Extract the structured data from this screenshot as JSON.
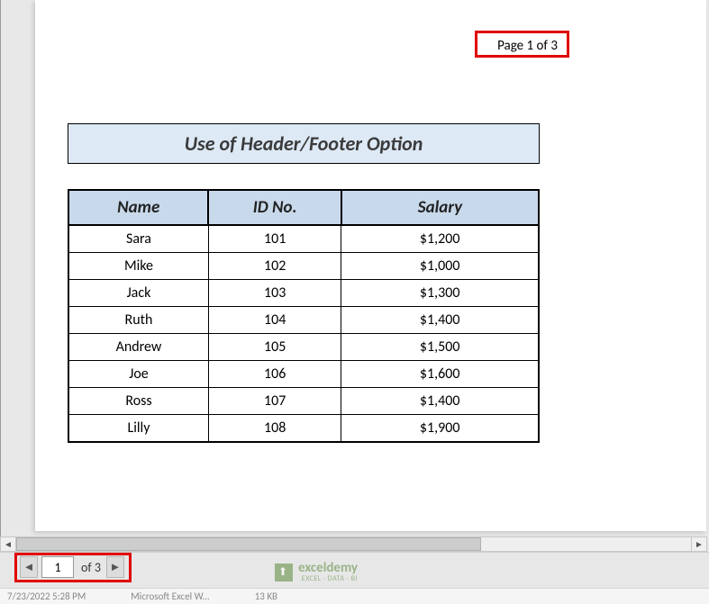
{
  "header": {
    "page_text": "Page 1 of 3"
  },
  "title": "Use of Header/Footer Option",
  "table": {
    "columns": [
      "Name",
      "ID No.",
      "Salary"
    ],
    "rows": [
      {
        "name": "Sara",
        "id": "101",
        "salary": "$1,200"
      },
      {
        "name": "Mike",
        "id": "102",
        "salary": "$1,000"
      },
      {
        "name": "Jack",
        "id": "103",
        "salary": "$1,300"
      },
      {
        "name": "Ruth",
        "id": "104",
        "salary": "$1,400"
      },
      {
        "name": "Andrew",
        "id": "105",
        "salary": "$1,500"
      },
      {
        "name": "Joe",
        "id": "106",
        "salary": "$1,600"
      },
      {
        "name": "Ross",
        "id": "107",
        "salary": "$1,400"
      },
      {
        "name": "Lilly",
        "id": "108",
        "salary": "$1,900"
      }
    ]
  },
  "pager": {
    "current": "1",
    "of_label": "of 3"
  },
  "watermark": {
    "brand": "exceldemy",
    "tagline": "EXCEL · DATA · BI"
  },
  "truncated": {
    "date": "7/23/2022 5:28 PM",
    "app": "Microsoft Excel W...",
    "size": "13 KB"
  }
}
